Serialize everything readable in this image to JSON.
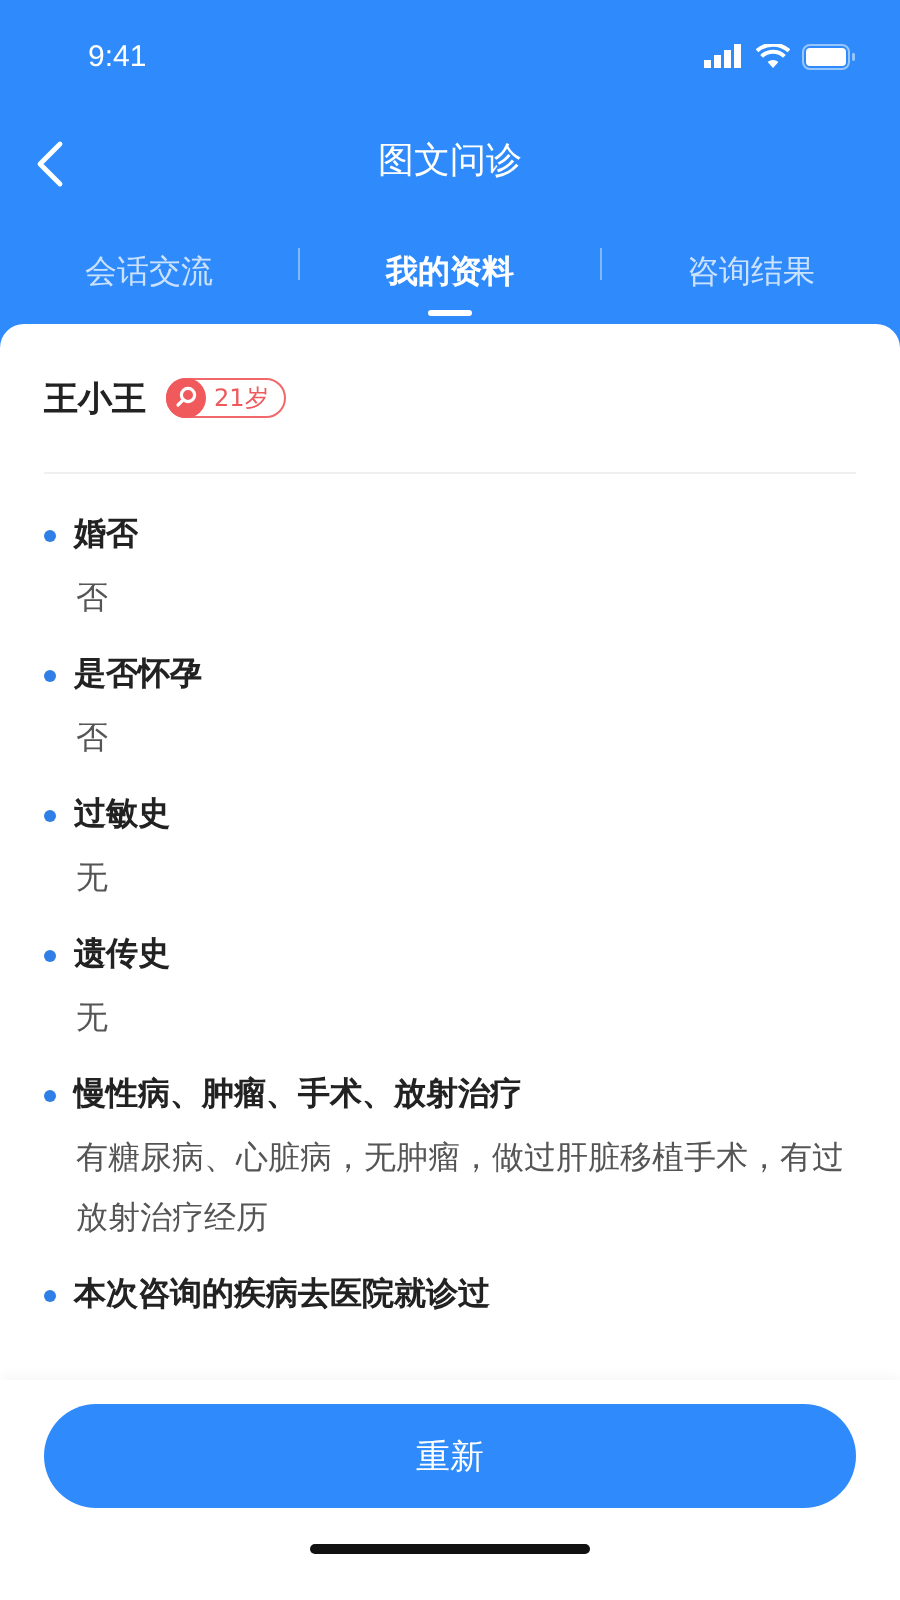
{
  "status_bar": {
    "time": "9:41"
  },
  "nav": {
    "title": "图文问诊"
  },
  "tabs": [
    {
      "label": "会话交流",
      "selected": false
    },
    {
      "label": "我的资料",
      "selected": true
    },
    {
      "label": "咨询结果",
      "selected": false
    }
  ],
  "patient": {
    "name": "王小王",
    "age": "21岁"
  },
  "fields": [
    {
      "label": "婚否",
      "value": "否"
    },
    {
      "label": "是否怀孕",
      "value": "否"
    },
    {
      "label": "过敏史",
      "value": "无"
    },
    {
      "label": "遗传史",
      "value": "无"
    },
    {
      "label": "慢性病、肿瘤、手术、放射治疗",
      "value": "有糖尿病、心脏病，无肿瘤，做过肝脏移植手术，有过放射治疗经历"
    },
    {
      "label": "本次咨询的疾病去医院就诊过"
    }
  ],
  "footer": {
    "button": "重新"
  }
}
